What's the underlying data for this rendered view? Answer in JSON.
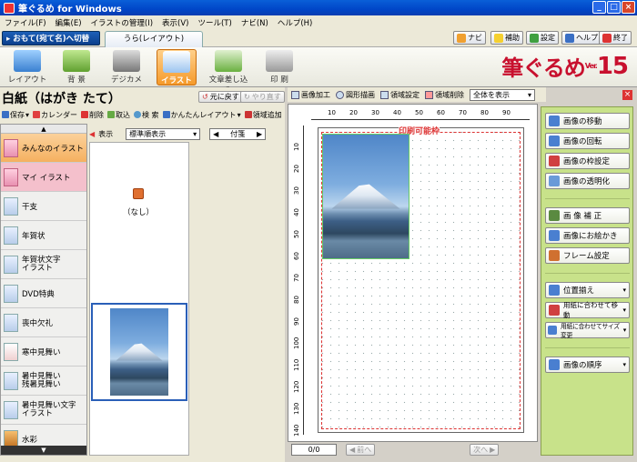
{
  "window": {
    "title": "筆ぐるめ for Windows",
    "controls": [
      "_",
      "□",
      "×"
    ]
  },
  "menu": [
    "ファイル(F)",
    "編集(E)",
    "イラストの管理(I)",
    "表示(V)",
    "ツール(T)",
    "ナビ(N)",
    "ヘルプ(H)"
  ],
  "tabrow": {
    "omote_button": "▸ おもて(宛て名)へ切替",
    "ura_tab": "うら(レイアウト)",
    "buttons": [
      "ナビ",
      "補助",
      "設定",
      "ヘルプ",
      "終了"
    ]
  },
  "modes": [
    "レイアウト",
    "背 景",
    "デジカメ",
    "イラスト",
    "文章差し込み",
    "印 刷"
  ],
  "active_mode": "イラスト",
  "brand": {
    "name": "筆ぐるめ",
    "ver": "Ver.",
    "num": "15"
  },
  "left": {
    "title": "白紙（はがき たて）",
    "undo": "元に戻す",
    "redo": "やり直す",
    "tools": [
      "保存",
      "カレンダー",
      "削除",
      "取込",
      "検 索",
      "かんたんレイアウト",
      "領域追加"
    ],
    "display_label": "表示",
    "sort_select": "標準順表示",
    "nav_select": "付箋",
    "none_label": "（なし）",
    "scroll_up": "▲",
    "scroll_down": "▼",
    "categories": [
      "みんなのイラスト",
      "マイ イラスト",
      "干支",
      "年賀状",
      "年賀状文字\nイラスト",
      "DVD特典",
      "喪中欠礼",
      "寒中見舞い",
      "暑中見舞い\n残暑見舞い",
      "暑中見舞い文字\nイラスト",
      "水彩"
    ]
  },
  "work": {
    "tools": [
      "画像加工",
      "図形描画",
      "領域設定",
      "領域削除"
    ],
    "zoom_select": "全体を表示",
    "print_label": "印刷可能枠",
    "page_counter": "0/0",
    "prev": "前へ",
    "next": "次へ",
    "ruler_top": [
      "10",
      "20",
      "30",
      "40",
      "50",
      "60",
      "70",
      "80",
      "90"
    ],
    "ruler_left": [
      "10",
      "20",
      "30",
      "40",
      "50",
      "60",
      "70",
      "80",
      "90",
      "100",
      "110",
      "120",
      "130",
      "140"
    ]
  },
  "right_tools": {
    "group1": [
      "画像の移動",
      "画像の回転",
      "画像の枠設定",
      "画像の透明化"
    ],
    "group2": [
      "画 像 補 正",
      "画像にお絵かき",
      "フレーム設定"
    ],
    "group3": [
      "位置揃え",
      "用紙に合わせて移動",
      "用紙に合わせてサイズ変更"
    ],
    "group4": [
      "画像の順序"
    ]
  },
  "colors": {
    "accent": "#f59a2a",
    "titlebar": "#0046c8",
    "panel_green": "#c8e28a",
    "print_frame": "#dd3333"
  }
}
